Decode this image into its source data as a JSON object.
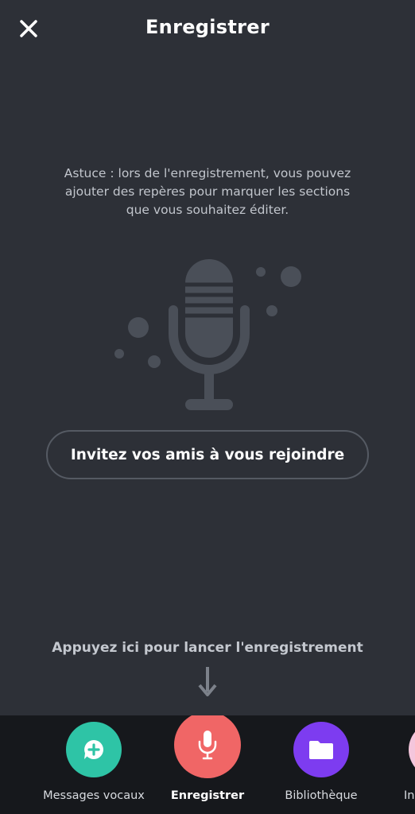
{
  "header": {
    "title": "Enregistrer",
    "close_icon": "close-icon"
  },
  "main": {
    "tip": "Astuce : lors de l'enregistrement, vous pouvez ajouter des repères pour marquer les sections que vous souhaitez éditer.",
    "illustration_icon": "microphone-icon",
    "invite_label": "Invitez vos amis à vous rejoindre",
    "hint": "Appuyez ici pour lancer l'enregistrement",
    "hint_icon": "arrow-down-icon"
  },
  "tabbar": {
    "items": [
      {
        "label": "Messages vocaux",
        "icon": "voice-message-add-icon",
        "color": "#2ec4a6"
      },
      {
        "label": "Enregistrer",
        "icon": "microphone-icon",
        "color": "#f06666",
        "active": true
      },
      {
        "label": "Bibliothèque",
        "icon": "folder-icon",
        "color": "#7d3cf0"
      },
      {
        "label": "In",
        "icon": "partial-tab-icon",
        "color": "#f4c6dc"
      }
    ]
  },
  "colors": {
    "background": "#2d3037",
    "tabbar_background": "#16181c",
    "illustration": "#4a4f58"
  }
}
